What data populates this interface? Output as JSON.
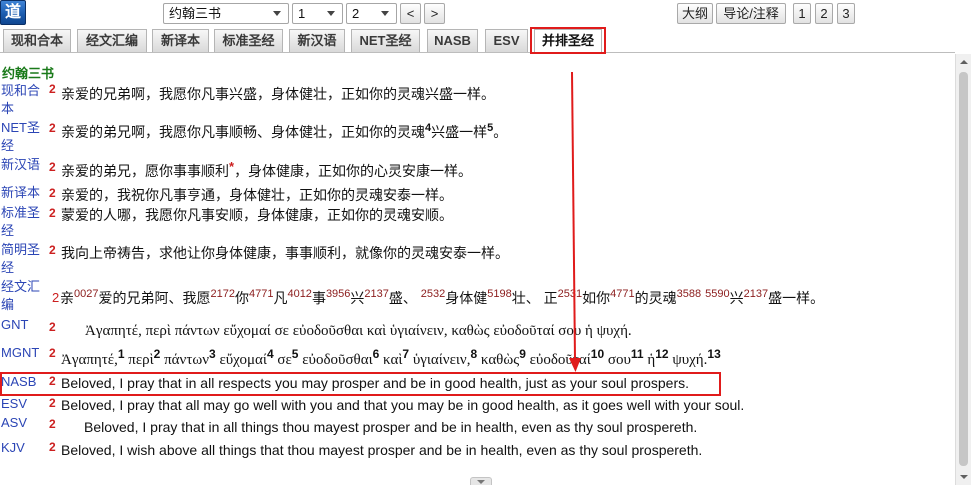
{
  "toolbar": {
    "logo": "道",
    "book": "约翰三书",
    "chapter": "1",
    "verse": "2",
    "prev": "<",
    "next": ">",
    "outline": "大纲",
    "intro_notes": "导论/注释",
    "font_size_buttons": [
      "1",
      "2",
      "3"
    ]
  },
  "tabs": [
    {
      "label": "现和合本"
    },
    {
      "label": "经文汇编"
    },
    {
      "label": "新译本"
    },
    {
      "label": "标准圣经"
    },
    {
      "label": "新汉语"
    },
    {
      "label": "NET圣经"
    },
    {
      "label": "NASB"
    },
    {
      "label": "ESV"
    },
    {
      "label": "并排圣经",
      "active": true
    }
  ],
  "passage": {
    "book_heading": "约翰三书",
    "rows": [
      {
        "version": "现和合本",
        "verse": "2",
        "segments": [
          {
            "t": "亲爱的兄弟啊，我愿你凡事兴盛，身体健壮，正如你的灵魂兴盛一样。"
          }
        ]
      },
      {
        "version": "NET圣经",
        "verse": "2",
        "segments": [
          {
            "t": "亲爱的弟兄啊，我愿你凡事顺畅、身体健壮，正如你的灵魂"
          },
          {
            "sup": "4"
          },
          {
            "t": "兴盛一样"
          },
          {
            "sup": "5"
          },
          {
            "t": "。"
          }
        ]
      },
      {
        "version": "新汉语",
        "verse": "2",
        "segments": [
          {
            "t": "亲爱的弟兄，愿你事事顺利"
          },
          {
            "note": "*"
          },
          {
            "t": "，身体健康，正如你的心灵安康一样。"
          }
        ]
      },
      {
        "version": "新译本",
        "verse": "2",
        "segments": [
          {
            "t": "亲爱的，我祝你凡事亨通，身体健壮，正如你的灵魂安泰一样。"
          }
        ]
      },
      {
        "version": "标准圣经",
        "verse": "2",
        "segments": [
          {
            "t": "蒙爱的人哪，我愿你凡事安顺，身体健康，正如你的灵魂安顺。"
          }
        ]
      },
      {
        "version": "简明圣经",
        "verse": "2",
        "segments": [
          {
            "t": "我向上帝祷告，求他让你身体健康，事事顺利，就像你的灵魂安泰一样。"
          }
        ]
      },
      {
        "version": "经文汇编",
        "verse": "2",
        "segments": [
          {
            "t": "亲"
          },
          {
            "strongs": "0027"
          },
          {
            "t": "爱的兄弟阿、我愿"
          },
          {
            "strongs": "2172"
          },
          {
            "t": "你"
          },
          {
            "strongs": "4771"
          },
          {
            "t": "凡"
          },
          {
            "strongs": "4012"
          },
          {
            "t": "事"
          },
          {
            "strongs": "3956"
          },
          {
            "t": "兴"
          },
          {
            "strongs": "2137"
          },
          {
            "t": "盛、 "
          },
          {
            "strongs": "2532"
          },
          {
            "t": "身体健"
          },
          {
            "strongs": "5198"
          },
          {
            "t": "壮、 正"
          },
          {
            "strongs": "2531"
          },
          {
            "t": "如你"
          },
          {
            "strongs": "4771"
          },
          {
            "t": "的灵魂"
          },
          {
            "strongs": "3588"
          },
          {
            "strongs": "5590"
          },
          {
            "t": "兴"
          },
          {
            "strongs": "2137"
          },
          {
            "t": "盛一样。"
          }
        ]
      },
      {
        "version": "GNT",
        "verse": "2",
        "segments": [
          {
            "t": "Ἀγαπητέ, περὶ πάντων εὔχομαί σε εὐοδοῦσθαι καὶ ὑγιαίνειν, καθὼς εὐοδοῦταί σου ἡ ψυχή."
          }
        ]
      },
      {
        "version": "MGNT",
        "verse": "2",
        "segments": [
          {
            "t": "Ἀγαπητέ,"
          },
          {
            "sup": "1"
          },
          {
            "t": " περὶ"
          },
          {
            "sup": "2"
          },
          {
            "t": " πάντων"
          },
          {
            "sup": "3"
          },
          {
            "t": " εὔχομαί"
          },
          {
            "sup": "4"
          },
          {
            "t": " σε"
          },
          {
            "sup": "5"
          },
          {
            "t": " εὐοδοῦσθαι"
          },
          {
            "sup": "6"
          },
          {
            "t": " καὶ"
          },
          {
            "sup": "7"
          },
          {
            "t": " ὑγιαίνειν,"
          },
          {
            "sup": "8"
          },
          {
            "t": " καθὼς"
          },
          {
            "sup": "9"
          },
          {
            "t": " εὐοδοῦταί"
          },
          {
            "sup": "10"
          },
          {
            "t": " σου"
          },
          {
            "sup": "11"
          },
          {
            "t": " ἡ"
          },
          {
            "sup": "12"
          },
          {
            "t": " ψυχή."
          },
          {
            "sup": "13"
          }
        ]
      },
      {
        "version": "NASB",
        "verse": "2",
        "segments": [
          {
            "t": "Beloved, I pray that in all respects you may prosper and be in good health, just as your soul prospers."
          }
        ]
      },
      {
        "version": "ESV",
        "verse": "2",
        "segments": [
          {
            "t": "Beloved, I pray that all may go well with you and that you may be in good health, as it goes well with your soul."
          }
        ]
      },
      {
        "version": "ASV",
        "verse": "2",
        "segments": [
          {
            "t": "Beloved, I pray that in all things thou mayest prosper and be in health, even as thy soul prospereth."
          }
        ]
      },
      {
        "version": "KJV",
        "verse": "2",
        "segments": [
          {
            "t": "Beloved, I wish above all things that thou mayest prosper and be in health, even as thy soul prospereth."
          }
        ]
      }
    ]
  },
  "colors": {
    "book_heading": "#1a7a1a",
    "version_link": "#2b45b5",
    "verse_number": "#cc1f1f",
    "strongs_number": "#8b1c1c",
    "annotation_red": "#e01b1b",
    "logo_blue": "#1c5db0"
  }
}
